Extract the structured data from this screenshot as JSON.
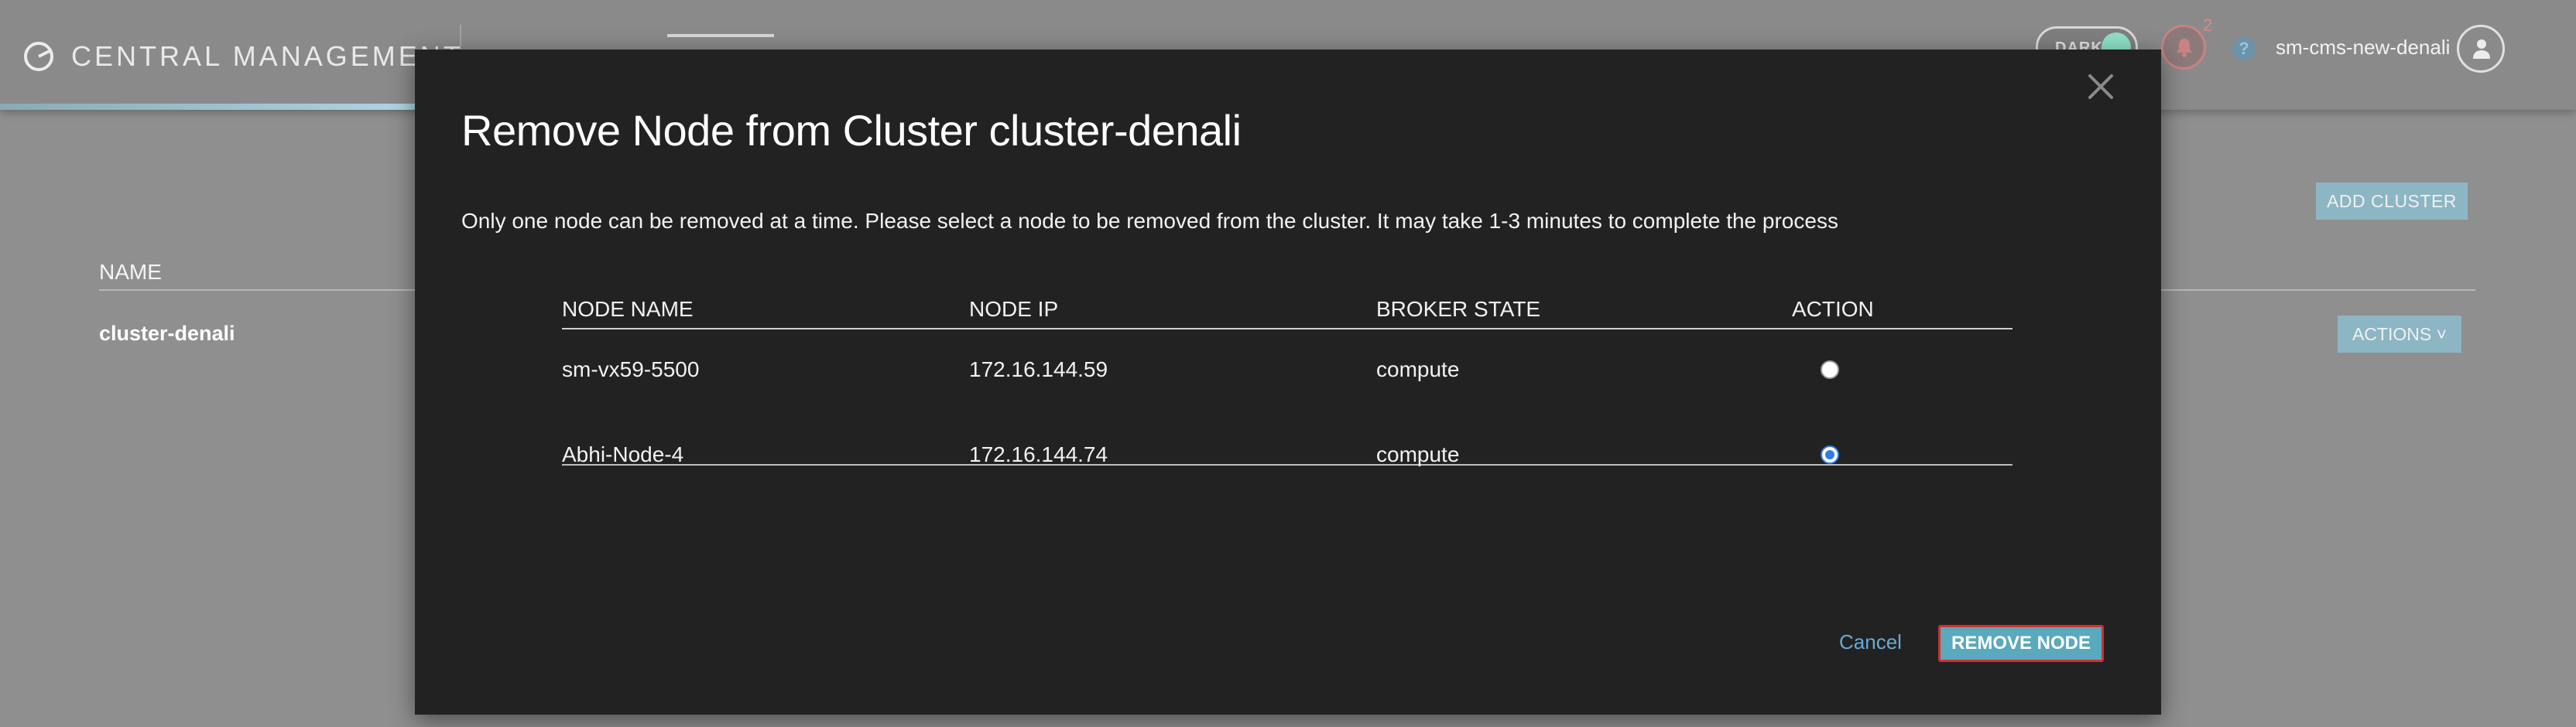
{
  "header": {
    "brand": "CENTRAL MANAGEMENT",
    "dark_toggle_label": "DARK",
    "notification_count": "2",
    "help_icon": "?",
    "username": "sm-cms-new-denali"
  },
  "page": {
    "add_cluster_label": "ADD CLUSTER",
    "name_column_header": "NAME",
    "cluster_name": "cluster-denali",
    "actions_label": "ACTIONS ˅"
  },
  "modal": {
    "title": "Remove Node from Cluster cluster-denali",
    "description": "Only one node can be removed at a time. Please select a node to be removed from the cluster. It may take 1-3 minutes to complete the process",
    "columns": [
      "NODE NAME",
      "NODE IP",
      "BROKER STATE",
      "ACTION"
    ],
    "rows": [
      {
        "node_name": "sm-vx59-5500",
        "node_ip": "172.16.144.59",
        "broker_state": "compute",
        "selected": false
      },
      {
        "node_name": "Abhi-Node-4",
        "node_ip": "172.16.144.74",
        "broker_state": "compute",
        "selected": true
      }
    ],
    "cancel_label": "Cancel",
    "remove_label": "REMOVE NODE"
  },
  "colors": {
    "modal_bg": "#222222",
    "overlay_bg": "#8f8f8f",
    "primary_button": "#5aa9bd",
    "focus_ring": "#d22f2f",
    "link": "#6aa9d6"
  },
  "icons": [
    "brand-logo-icon",
    "bell-icon",
    "help-icon",
    "user-icon",
    "close-icon"
  ]
}
